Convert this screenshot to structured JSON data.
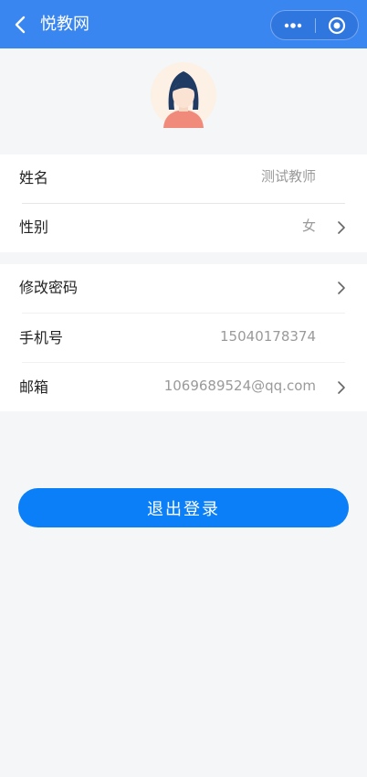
{
  "nav": {
    "title": "悦教网",
    "back_icon": "chevron-left-icon",
    "more_icon": "more-dots-icon",
    "close_icon": "target-icon"
  },
  "profile": {
    "avatar_icon": "female-avatar-icon",
    "rows": [
      {
        "label": "姓名",
        "value": "测试教师"
      },
      {
        "label": "性别",
        "value": "女"
      }
    ],
    "account_rows": [
      {
        "label": "修改密码",
        "value": ""
      },
      {
        "label": "手机号",
        "value": "15040178374"
      },
      {
        "label": "邮箱",
        "value": "1069689524@qq.com"
      }
    ]
  },
  "logout_label": "退出登录",
  "colors": {
    "nav": "#3a86f0",
    "button": "#0a7ff7",
    "background": "#f5f6f7"
  }
}
